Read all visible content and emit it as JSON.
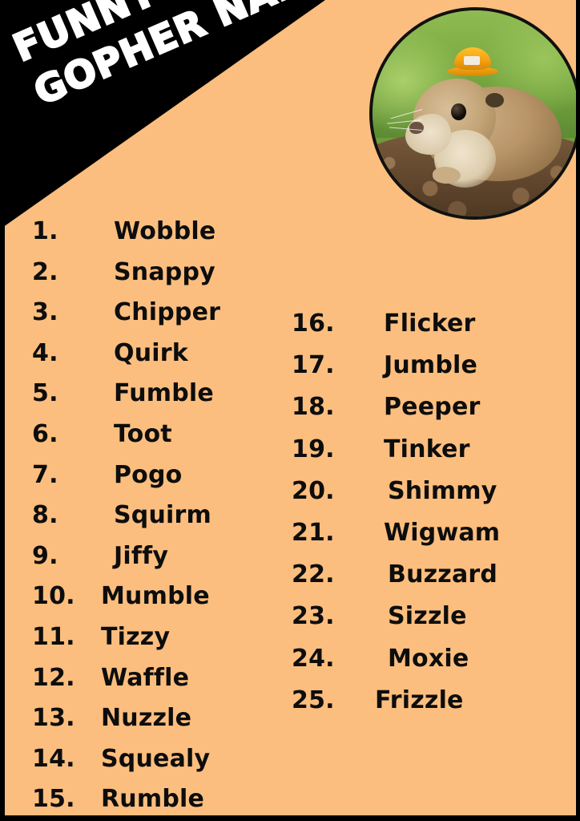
{
  "poster": {
    "title_lines": [
      "FUNNY",
      "GOPHER NAMES"
    ],
    "background_color": "#fcbe7e",
    "banner_color": "#000000",
    "title_color": "#ffffff",
    "text_color": "#0d0d0d",
    "border_color": "#000000"
  },
  "photo": {
    "alt": "gopher wearing an orange hard hat sitting on dirt mound",
    "icon": "gopher-photo",
    "hat_color": "#f5a213",
    "grass_color": "#7fae45",
    "dirt_color": "#6b4f33"
  },
  "list": {
    "left_column": [
      {
        "number": "1.",
        "name": "Wobble"
      },
      {
        "number": "2.",
        "name": "Snappy"
      },
      {
        "number": "3.",
        "name": "Chipper"
      },
      {
        "number": "4.",
        "name": "Quirk"
      },
      {
        "number": "5.",
        "name": "Fumble"
      },
      {
        "number": "6.",
        "name": "Toot"
      },
      {
        "number": "7.",
        "name": "Pogo"
      },
      {
        "number": "8.",
        "name": "Squirm"
      },
      {
        "number": "9.",
        "name": "Jiffy"
      },
      {
        "number": "10.",
        "name": "Mumble"
      },
      {
        "number": "11.",
        "name": "Tizzy"
      },
      {
        "number": "12.",
        "name": "Waffle"
      },
      {
        "number": "13.",
        "name": "Nuzzle"
      },
      {
        "number": "14.",
        "name": "Squealy"
      },
      {
        "number": "15.",
        "name": "Rumble"
      }
    ],
    "right_column": [
      {
        "number": "16.",
        "name": "Flicker"
      },
      {
        "number": "17.",
        "name": "Jumble"
      },
      {
        "number": "18.",
        "name": "Peeper"
      },
      {
        "number": "19.",
        "name": "Tinker"
      },
      {
        "number": "20.",
        "name": "Shimmy"
      },
      {
        "number": "21.",
        "name": "Wigwam"
      },
      {
        "number": "22.",
        "name": "Buzzard"
      },
      {
        "number": "23.",
        "name": "Sizzle"
      },
      {
        "number": "24.",
        "name": "Moxie"
      },
      {
        "number": "25.",
        "name": "Frizzle"
      }
    ]
  }
}
